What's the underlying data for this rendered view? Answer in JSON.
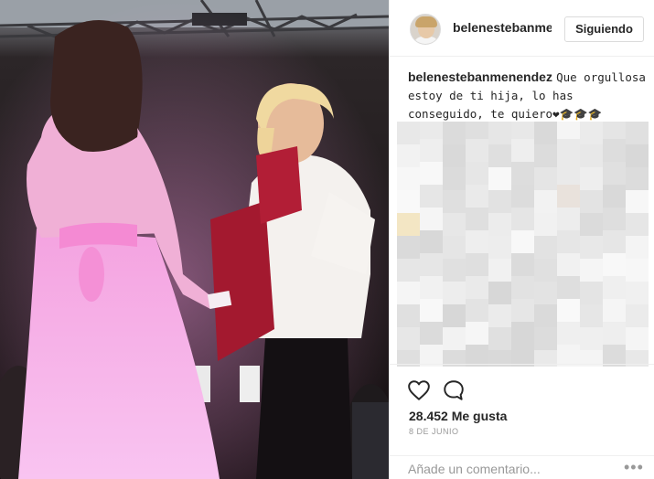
{
  "post": {
    "image_alt": "Graduation photo on stage"
  },
  "header": {
    "username": "belenestebanmenendez",
    "follow_label": "Siguiendo"
  },
  "caption": {
    "author": "belenestebanmenendez",
    "text": "Que orgullosa estoy de ti hija, lo has conseguido, te quiero❤🎓🎓🎓"
  },
  "stats": {
    "likes": "28.452 Me gusta",
    "date": "8 DE JUNIO"
  },
  "comment_box": {
    "placeholder": "Añade un comentario..."
  },
  "icons": {
    "like": "heart-icon",
    "comment": "comment-bubble-icon",
    "more": "more-options-icon"
  },
  "colors": {
    "text": "#262626",
    "muted": "#999999",
    "border": "#efefef"
  }
}
